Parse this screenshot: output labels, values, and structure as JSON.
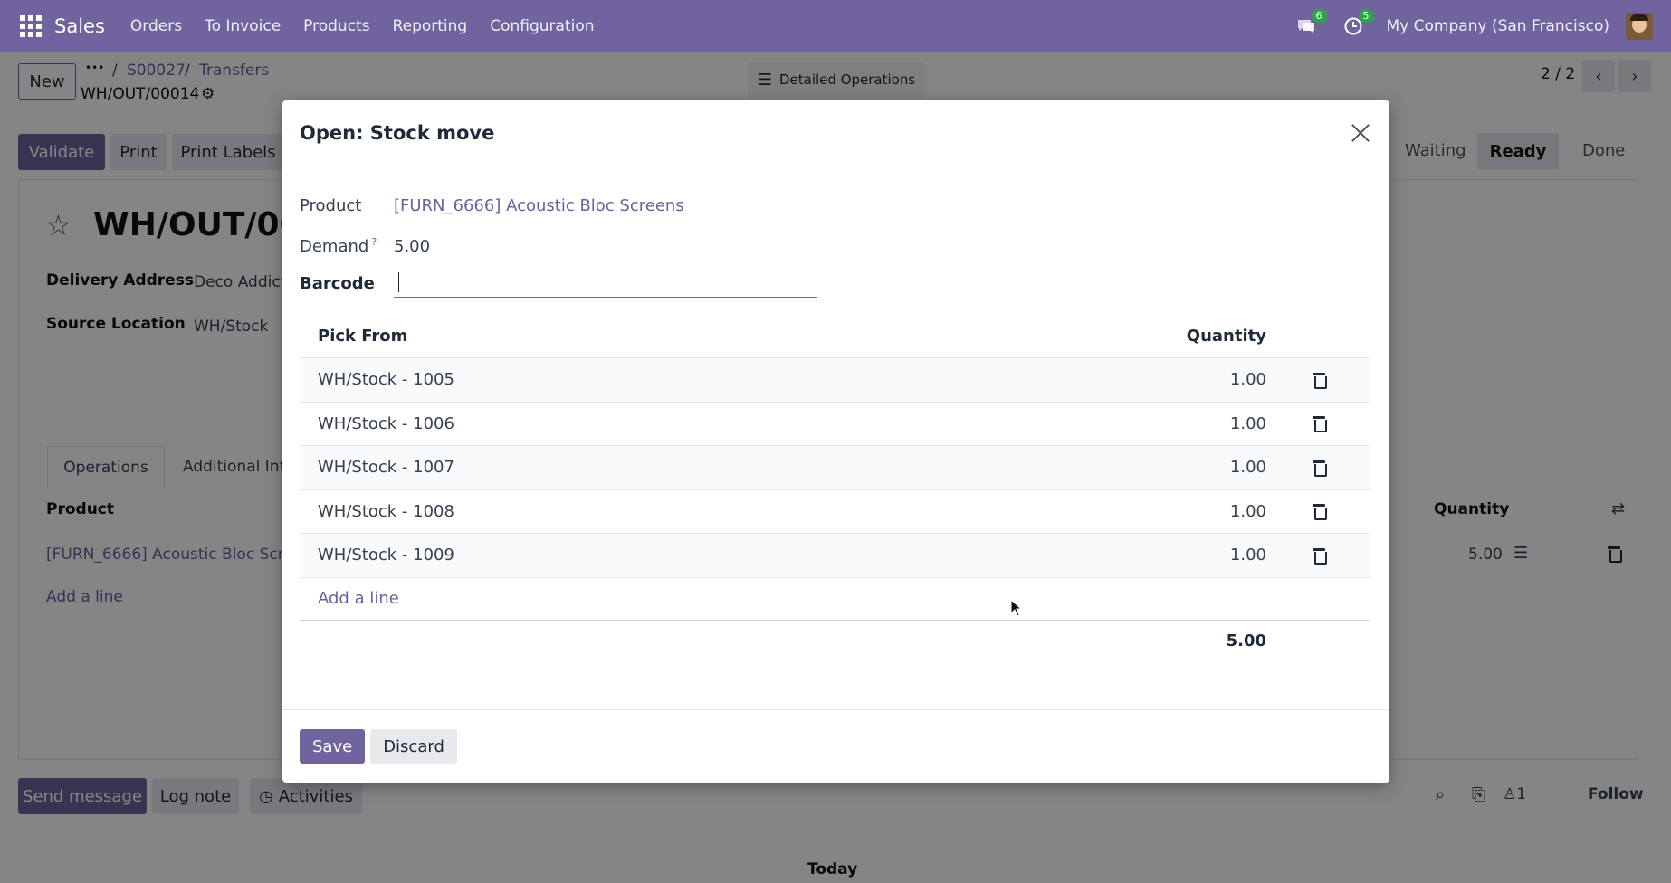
{
  "navbar": {
    "brand": "Sales",
    "menu": [
      "Orders",
      "To Invoice",
      "Products",
      "Reporting",
      "Configuration"
    ],
    "messages_badge": "6",
    "activities_badge": "5",
    "company": "My Company (San Francisco)"
  },
  "page": {
    "new_button": "New",
    "breadcrumb_dots": "•••",
    "breadcrumb_1": "S00027",
    "breadcrumb_2": "Transfers",
    "record_name": "WH/OUT/00014",
    "detailed_ops": "Detailed Operations",
    "pager": "2 / 2",
    "validate": "Validate",
    "print": "Print",
    "print_labels": "Print Labels",
    "status_waiting": "Waiting",
    "status_ready": "Ready",
    "status_done": "Done",
    "title": "WH/OUT/000",
    "delivery_address_label": "Delivery Address",
    "delivery_address_value": "Deco Addict",
    "source_location_label": "Source Location",
    "source_location_value": "WH/Stock",
    "tab_operations": "Operations",
    "tab_additional": "Additional Info",
    "col_product": "Product",
    "col_quantity": "Quantity",
    "line_product": "[FURN_6666] Acoustic Bloc Scree",
    "line_quantity": "5.00",
    "add_line": "Add a line",
    "send_message": "Send message",
    "log_note": "Log note",
    "activities": "Activities",
    "followers": "1",
    "follow": "Follow",
    "today": "Today"
  },
  "dialog": {
    "title": "Open: Stock move",
    "product_label": "Product",
    "product_value": "[FURN_6666] Acoustic Bloc Screens",
    "demand_label": "Demand",
    "demand_help": "?",
    "demand_value": "5.00",
    "barcode_label": "Barcode",
    "barcode_value": "",
    "col_pick_from": "Pick From",
    "col_quantity": "Quantity",
    "rows": [
      {
        "location": "WH/Stock - 1005",
        "quantity": "1.00"
      },
      {
        "location": "WH/Stock - 1006",
        "quantity": "1.00"
      },
      {
        "location": "WH/Stock - 1007",
        "quantity": "1.00"
      },
      {
        "location": "WH/Stock - 1008",
        "quantity": "1.00"
      },
      {
        "location": "WH/Stock - 1009",
        "quantity": "1.00"
      }
    ],
    "add_line": "Add a line",
    "total": "5.00",
    "save": "Save",
    "discard": "Discard"
  }
}
